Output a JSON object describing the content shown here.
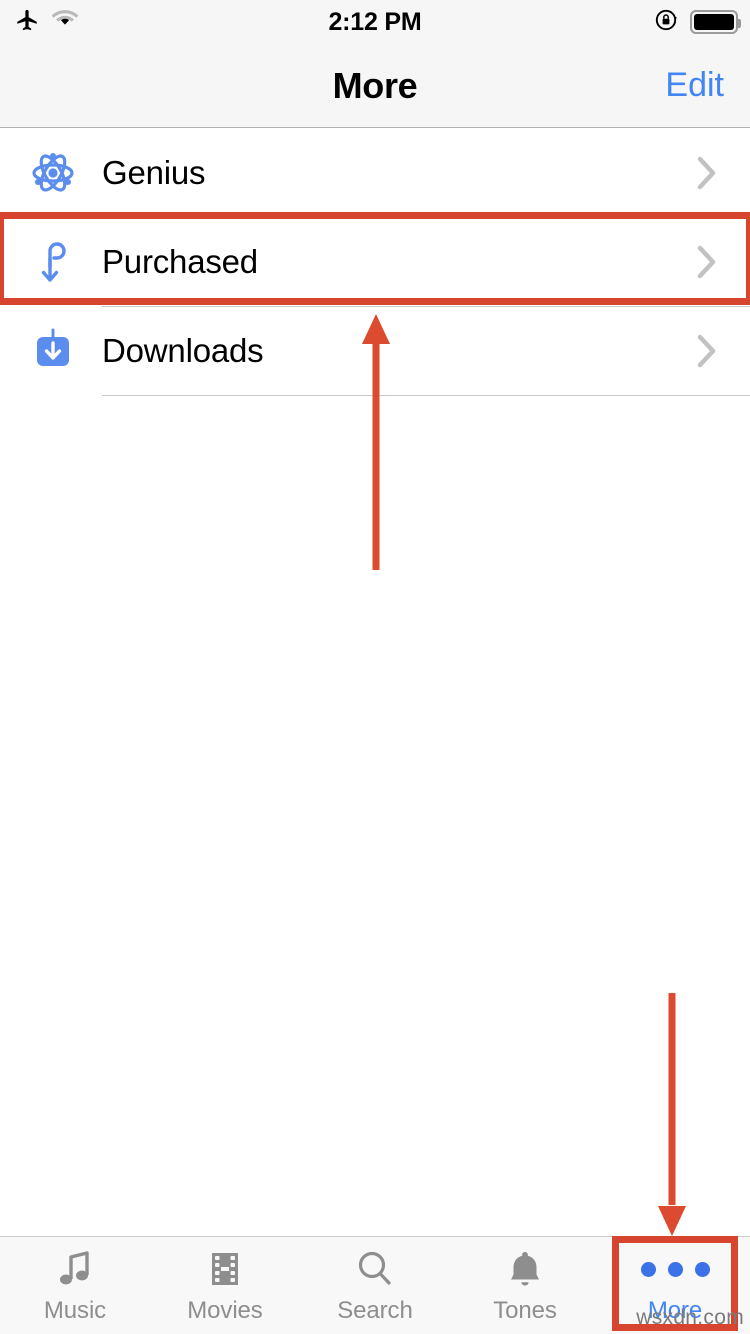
{
  "status_bar": {
    "airplane_icon": "airplane-icon",
    "wifi_icon": "wifi-icon",
    "time": "2:12 PM",
    "rotation_lock_icon": "rotation-lock-icon",
    "battery_icon": "battery-icon",
    "battery_level_percent": 100
  },
  "nav_bar": {
    "title": "More",
    "edit_label": "Edit"
  },
  "list": {
    "rows": [
      {
        "label": "Genius",
        "icon": "atom-icon",
        "chevron": "chevron-right-icon"
      },
      {
        "label": "Purchased",
        "icon": "purchased-note-icon",
        "chevron": "chevron-right-icon"
      },
      {
        "label": "Downloads",
        "icon": "download-box-icon",
        "chevron": "chevron-right-icon"
      }
    ]
  },
  "tab_bar": {
    "tabs": [
      {
        "label": "Music",
        "icon": "music-note-icon",
        "active": false
      },
      {
        "label": "Movies",
        "icon": "film-strip-icon",
        "active": false
      },
      {
        "label": "Search",
        "icon": "magnifier-icon",
        "active": false
      },
      {
        "label": "Tones",
        "icon": "bell-icon",
        "active": false
      },
      {
        "label": "More",
        "icon": "ellipsis-icon",
        "active": true
      }
    ]
  },
  "annotations": {
    "highlight_color": "#d8452f",
    "arrow_up_target": "Purchased",
    "arrow_down_target": "More",
    "boxes": [
      "purchased-row",
      "more-tab"
    ]
  },
  "watermark": {
    "text": "wsxdn.com"
  },
  "colors": {
    "accent_blue": "#4285f4",
    "icon_blue": "#5a8dee",
    "annotation_red": "#d8452f",
    "nav_background": "#f6f6f6",
    "tab_inactive": "#8e8e8e"
  }
}
